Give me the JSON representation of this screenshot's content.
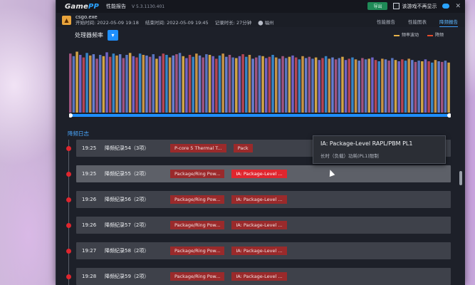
{
  "window": {
    "logo_main": "Game",
    "logo_accent": "PP",
    "title": "性能报告",
    "version": "V 5.3.1130.401",
    "top_button": "导出",
    "checkbox_label": "该游戏不再显示"
  },
  "session": {
    "exe": "csgo.exe",
    "start": "开始时间: 2022-05-09 19:18",
    "end": "结束时间: 2022-05-09 19:45",
    "duration": "记录时长: 27分钟",
    "location": "福州"
  },
  "tabs": [
    {
      "label": "性能报告"
    },
    {
      "label": "性能图表"
    },
    {
      "label": "降频报告",
      "active": true
    }
  ],
  "chart_header": {
    "label": "处理器频率",
    "legend": [
      "频率波动",
      "降频"
    ]
  },
  "chart_data": {
    "type": "bar",
    "title": "",
    "xlabel": "",
    "ylabel": "",
    "ylim": [
      0,
      100
    ],
    "series": [
      {
        "name": "频率波动",
        "color": "#e6b24a"
      },
      {
        "name": "降频",
        "color": "#e64b2a"
      }
    ],
    "values": [
      92,
      88,
      95,
      90,
      86,
      93,
      89,
      91,
      84,
      90,
      88,
      94,
      87,
      92,
      89,
      91,
      85,
      90,
      93,
      88,
      86,
      92,
      90,
      89,
      87,
      91,
      84,
      88,
      92,
      90,
      86,
      89,
      91,
      93,
      88,
      85,
      90,
      87,
      92,
      89,
      86,
      91,
      90,
      88,
      84,
      89,
      92,
      87,
      90,
      86,
      85,
      88,
      91,
      87,
      90,
      84,
      86,
      89,
      88,
      85,
      87,
      90,
      86,
      84,
      88,
      85,
      87,
      89,
      86,
      83,
      88,
      85,
      87,
      84,
      86,
      82,
      85,
      88,
      84,
      86,
      83,
      85,
      87,
      82,
      84,
      86,
      83,
      81,
      85,
      83,
      84,
      86,
      82,
      80,
      84,
      83,
      81,
      85,
      82,
      80,
      83,
      81,
      84,
      82,
      79,
      81,
      80,
      83,
      80,
      78,
      82,
      80,
      79,
      81,
      78
    ]
  },
  "section_title": "降频日志",
  "rows": [
    {
      "time": "19:25",
      "rec": "降频纪录54（3项）",
      "tags": [
        "P-core 5 Thermal T...",
        "Pack"
      ],
      "hl": false
    },
    {
      "time": "19:25",
      "rec": "降频纪录55（2项）",
      "tags": [
        "Package/Ring Pow...",
        "IA: Package-Level ..."
      ],
      "hl": true
    },
    {
      "time": "19:26",
      "rec": "降频纪录56（2项）",
      "tags": [
        "Package/Ring Pow...",
        "IA: Package-Level ..."
      ],
      "hl": false
    },
    {
      "time": "19:26",
      "rec": "降频纪录57（2项）",
      "tags": [
        "Package/Ring Pow...",
        "IA: Package-Level ..."
      ],
      "hl": false
    },
    {
      "time": "19:27",
      "rec": "降频纪录58（2项）",
      "tags": [
        "Package/Ring Pow...",
        "IA: Package-Level ..."
      ],
      "hl": false
    },
    {
      "time": "19:28",
      "rec": "降频纪录59（2项）",
      "tags": [
        "Package/Ring Pow...",
        "IA: Package-Level ..."
      ],
      "hl": false
    }
  ],
  "tooltip": {
    "title": "IA: Package-Level RAPL/PBM PL1",
    "subtitle": "长时（负载）功耗(PL1)限制"
  }
}
